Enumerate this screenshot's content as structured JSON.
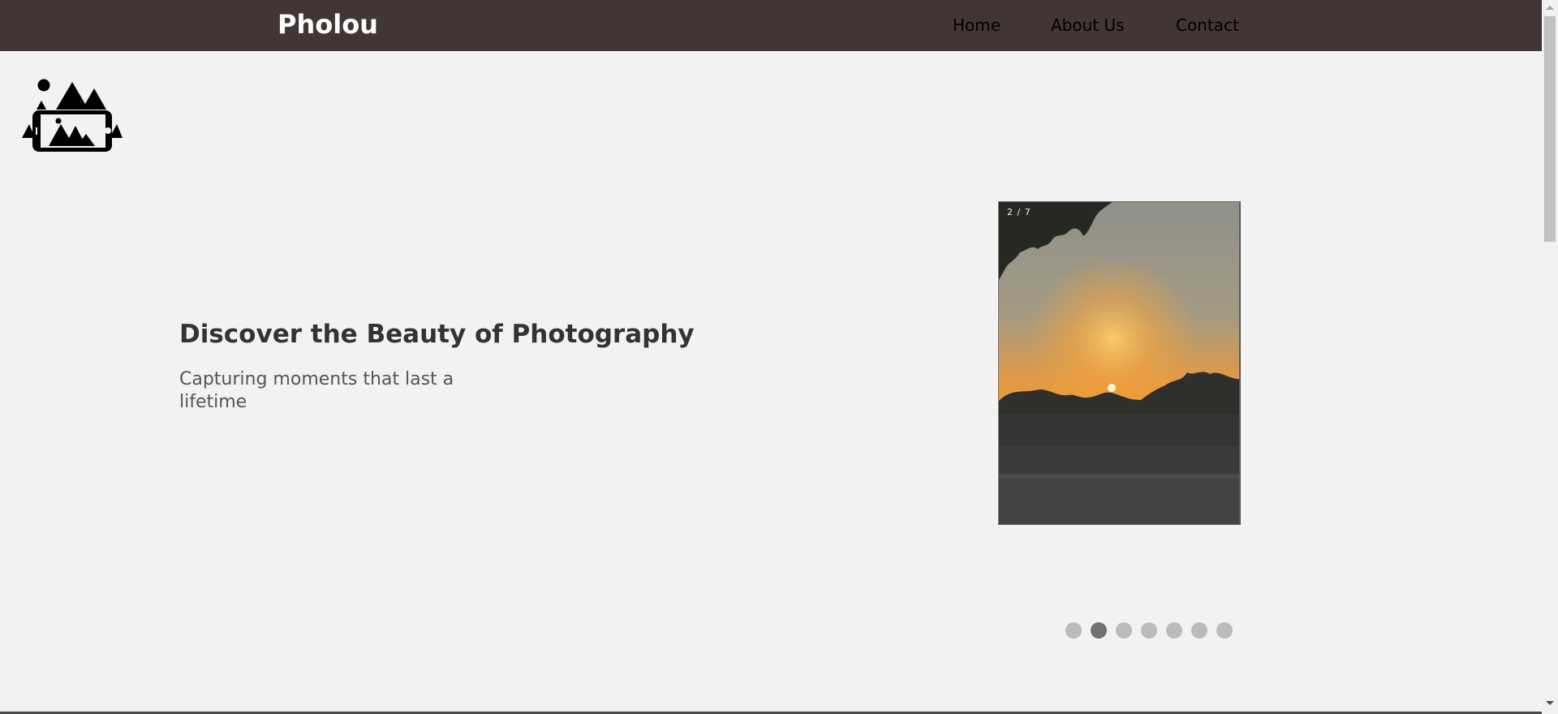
{
  "navbar": {
    "brand": "Pholou",
    "links": [
      {
        "label": "Home"
      },
      {
        "label": "About Us"
      },
      {
        "label": "Contact"
      }
    ]
  },
  "logo": {
    "icon": "mountains-phone-logo-icon"
  },
  "hero": {
    "title": "Discover the Beauty of Photography",
    "subtitle": "Capturing moments that last a lifetime"
  },
  "slideshow": {
    "counter": "2 / 7",
    "image": "sunset-photo",
    "current": 2,
    "total": 7
  },
  "colors": {
    "navbar_bg": "#423535",
    "page_bg": "#f2f2f2",
    "dot_inactive": "#bbbbbb",
    "dot_active": "#717171"
  }
}
